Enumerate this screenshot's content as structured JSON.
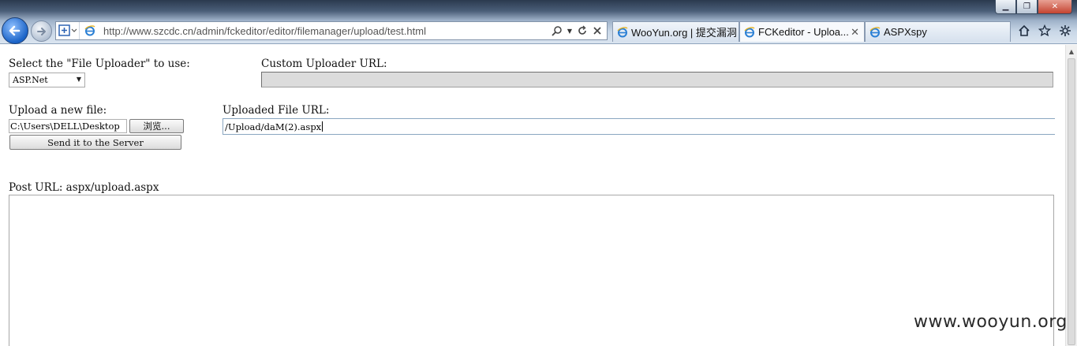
{
  "browser": {
    "address_url": "http://www.szcdc.cn/admin/fckeditor/editor/filemanager/upload/test.html",
    "tabs": [
      {
        "label": "WooYun.org | 提交漏洞",
        "active": false
      },
      {
        "label": "FCKeditor - Uploa...",
        "active": true
      },
      {
        "label": "ASPXspy",
        "active": false
      }
    ],
    "icons": [
      "back-arrow-icon",
      "forward-arrow-icon",
      "compat-view-icon",
      "search-icon",
      "refresh-icon",
      "stop-icon",
      "home-icon",
      "favorites-star-icon",
      "tools-gear-icon"
    ]
  },
  "page": {
    "select_label": "Select the \"File Uploader\" to use:",
    "uploader_selected": "ASP.Net",
    "custom_url_label": "Custom Uploader URL:",
    "custom_url_value": "",
    "upload_label": "Upload a new file:",
    "file_path_value": "C:\\Users\\DELL\\Desktop",
    "browse_label": "浏览...",
    "send_label": "Send it to the Server",
    "uploaded_url_label": "Uploaded File URL:",
    "uploaded_url_value": "/Upload/daM(2).aspx",
    "post_url_label": "Post URL: aspx/upload.aspx",
    "output_value": ""
  },
  "watermark": "www.wooyun.org"
}
